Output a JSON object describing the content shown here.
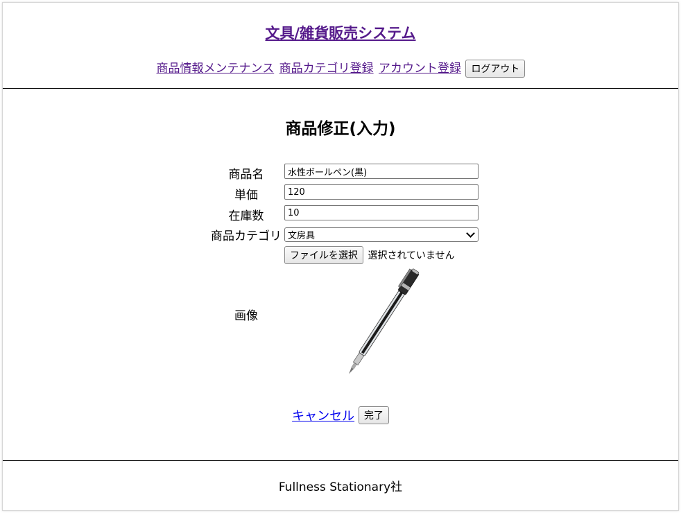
{
  "header": {
    "site_title": "文具/雑貨販売システム",
    "nav": {
      "item_maintenance": "商品情報メンテナンス",
      "category_register": "商品カテゴリ登録",
      "account_register": "アカウント登録",
      "logout_label": "ログアウト"
    }
  },
  "main": {
    "page_title": "商品修正(入力)",
    "form": {
      "name_label": "商品名",
      "name_value": "水性ボールペン(黒)",
      "price_label": "単価",
      "price_value": "120",
      "stock_label": "在庫数",
      "stock_value": "10",
      "category_label": "商品カテゴリ",
      "category_selected": "文房具",
      "file_button_label": "ファイルを選択",
      "file_status": "選択されていません",
      "image_label": "画像",
      "image_subject": "pen-image"
    },
    "actions": {
      "cancel_label": "キャンセル",
      "complete_label": "完了"
    }
  },
  "footer": {
    "company": "Fullness Stationary社"
  },
  "colors": {
    "visited_link": "#551a8b",
    "link": "#0000ee"
  }
}
